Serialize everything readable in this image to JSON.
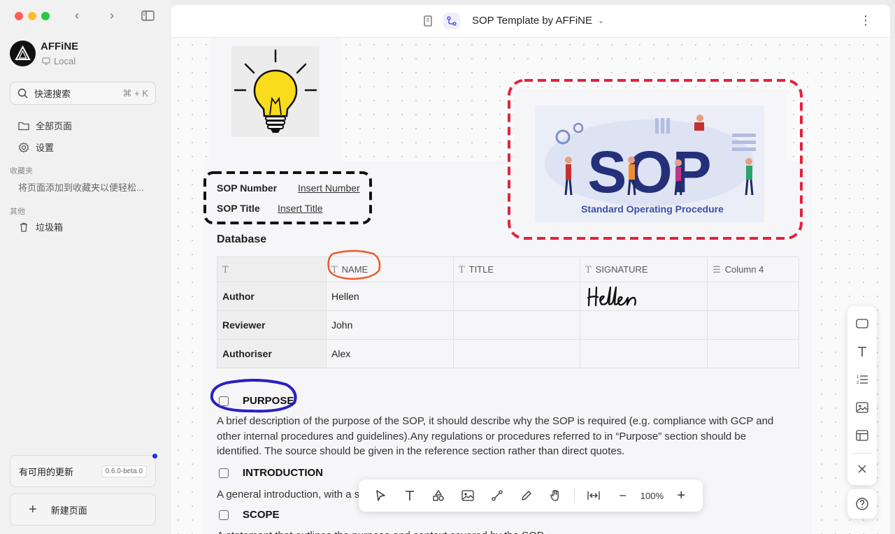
{
  "sidebar": {
    "workspace_name": "AFFiNE",
    "workspace_type": "Local",
    "search_label": "快速搜索",
    "search_shortcut": "⌘ + K",
    "all_pages": "全部页面",
    "settings": "设置",
    "favorites_section": "收藏夹",
    "favorites_hint": "将页面添加到收藏夹以便轻松...",
    "others_section": "其他",
    "trash": "垃圾箱",
    "update_label": "有可用的更新",
    "update_version": "0.6.0-beta.0",
    "new_page": "新建页面"
  },
  "header": {
    "title": "SOP Template by AFFiNE"
  },
  "doc": {
    "sop_number_label": "SOP Number",
    "sop_number_value": "Insert Number",
    "sop_title_label": "SOP Title",
    "sop_title_value": "Insert Title",
    "database_title": "Database",
    "sop_logo_text": "SOP",
    "sop_logo_caption": "Standard Operating Procedure",
    "table": {
      "columns": [
        "",
        "NAME",
        "TITLE",
        "SIGNATURE",
        "Column 4"
      ],
      "rows": [
        {
          "head": "Author",
          "name": "Hellen",
          "title": "",
          "signature": "Hellen",
          "col4": ""
        },
        {
          "head": "Reviewer",
          "name": "John",
          "title": "",
          "signature": "",
          "col4": ""
        },
        {
          "head": "Authoriser",
          "name": "Alex",
          "title": "",
          "signature": "",
          "col4": ""
        }
      ]
    },
    "purpose_heading": "PURPOSE",
    "purpose_text": "A brief description of the purpose of the SOP, it should describe why the SOP is required (e.g. compliance with GCP and other internal procedures and guidelines).Any regulations or procedures referred to in “Purpose” section should be identified. The source should be given in the reference section rather than direct quotes.",
    "intro_heading": "INTRODUCTION",
    "intro_text": "A general introduction, with a s",
    "scope_heading": "SCOPE",
    "scope_text": "A statement that outlines the purpose and context covered by the SOP"
  },
  "toolbar": {
    "zoom": "100%"
  },
  "colors": {
    "accent": "#2c2cd9",
    "red_dash": "#e0243e",
    "orange_circle": "#ec5a25",
    "blue_circle": "#2a1fc4"
  }
}
